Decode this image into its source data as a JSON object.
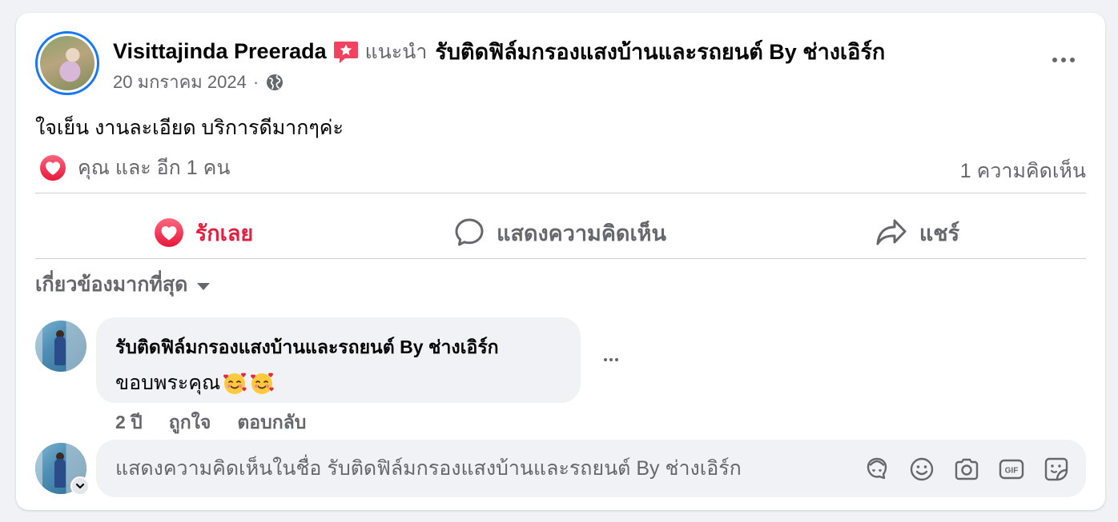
{
  "post": {
    "author": "Visittajinda Preerada",
    "recommends_label": "แนะนำ",
    "page_name": "รับติดฟิล์มกรองแสงบ้านและรถยนต์ By ช่างเอิร์ก",
    "date": "20 มกราคม 2024",
    "separator": "·",
    "body": "ใจเย็น งานละเอียด บริการดีมากๆค่ะ"
  },
  "reactions": {
    "summary": "คุณ และ อีก 1 คน",
    "comments": "1 ความคิดเห็น"
  },
  "actions": {
    "love": "รักเลย",
    "comment": "แสดงความคิดเห็น",
    "share": "แชร์"
  },
  "sort": {
    "label": "เกี่ยวข้องมากที่สุด"
  },
  "comment": {
    "author": "รับติดฟิล์มกรองแสงบ้านและรถยนต์ By ช่างเอิร์ก",
    "text": "ขอบพระคุณ",
    "age": "2 ปี",
    "like": "ถูกใจ",
    "reply": "ตอบกลับ"
  },
  "composer": {
    "placeholder": "แสดงความคิดเห็นในชื่อ รับติดฟิล์มกรองแสงบ้านและรถยนต์ By ช่างเอิร์ก",
    "tools": [
      "avatar-sticker-icon",
      "emoji-icon",
      "camera-icon",
      "gif-icon",
      "sticker-icon"
    ]
  },
  "colors": {
    "accent": "#1877f2",
    "love": "#e41e3f",
    "muted": "#65676b",
    "bubble": "#f0f2f5"
  }
}
